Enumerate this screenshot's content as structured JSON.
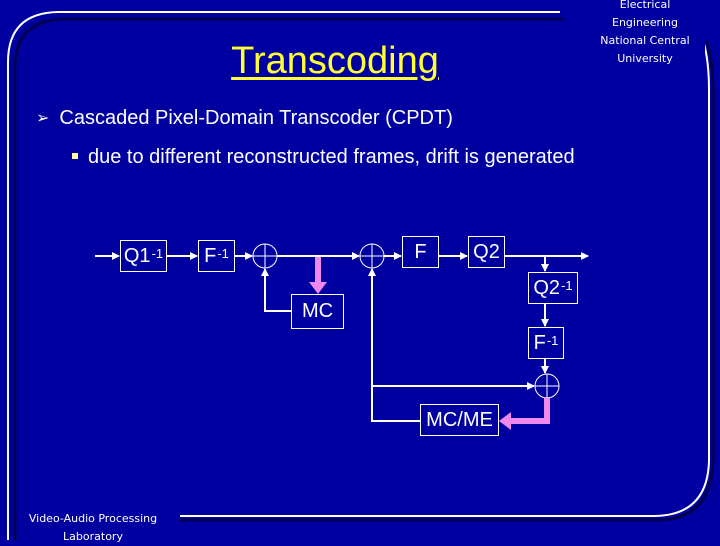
{
  "header": {
    "org_lines": [
      "Electrical Engineering",
      "National Central",
      "University"
    ],
    "title": "Transcoding"
  },
  "content": {
    "bullet1": {
      "marker": "➢",
      "text": "Cascaded Pixel-Domain Transcoder (CPDT)"
    },
    "bullet2": {
      "text": "due to different reconstructed frames, drift is generated"
    }
  },
  "diagram": {
    "blocks": {
      "q1_inv": {
        "base": "Q1",
        "sup": "-1"
      },
      "f_inv_1": {
        "base": "F",
        "sup": "-1"
      },
      "mc": {
        "base": "MC"
      },
      "f": {
        "base": "F"
      },
      "q2": {
        "base": "Q2"
      },
      "q2_inv": {
        "base": "Q2",
        "sup": "-1"
      },
      "f_inv_2": {
        "base": "F",
        "sup": "-1"
      },
      "mcme": {
        "base": "MC/ME"
      }
    },
    "colors": {
      "line": "#ffffff",
      "highlight_arrow": "#ee88ee"
    }
  },
  "footer": {
    "lab_lines": [
      "Video-Audio Processing",
      "Laboratory"
    ]
  },
  "theme": {
    "background": "#0000a0",
    "title_color": "#ffff33",
    "text_color": "#ffffff"
  }
}
